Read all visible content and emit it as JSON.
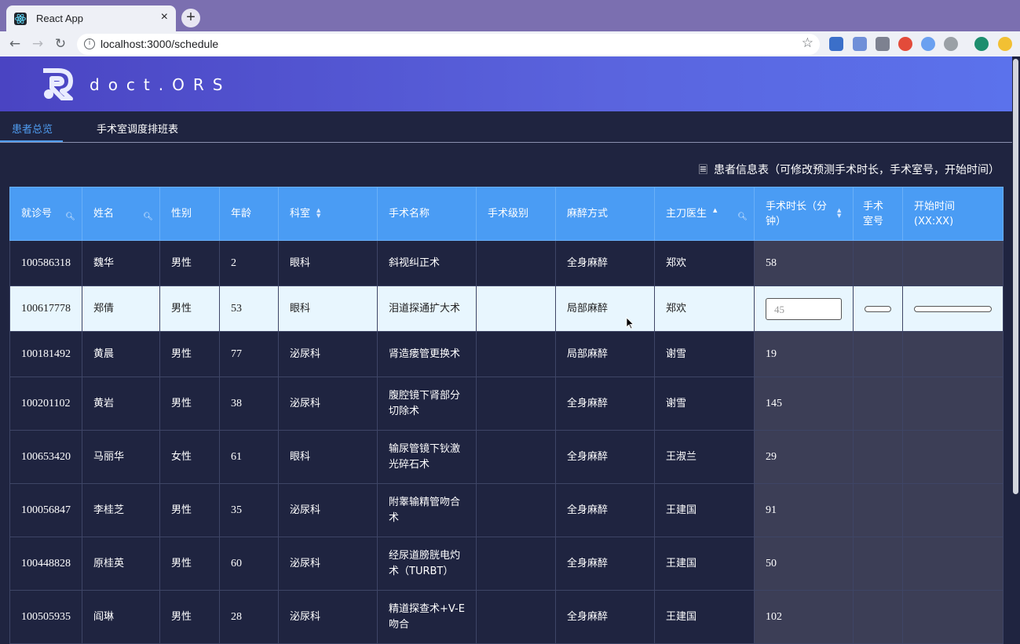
{
  "browser": {
    "tab_title": "React App",
    "tab_close": "×",
    "new_tab": "+",
    "url": "localhost:3000/schedule",
    "back": "←",
    "forward": "→",
    "reload": "↻",
    "star": "☆",
    "info": "i",
    "extensions": [
      "new-extension-icon",
      "translate-icon",
      "reader-icon",
      "chrome-icon",
      "send-icon",
      "vpn-icon",
      "profile-icon",
      "coin-icon"
    ]
  },
  "app": {
    "brand": "doct.ORS"
  },
  "tabs": [
    {
      "label": "患者总览",
      "active": true
    },
    {
      "label": "手术室调度排班表",
      "active": false
    }
  ],
  "table": {
    "title_icon": "🗏",
    "title": "患者信息表（可修改预测手术时长，手术室号，开始时间）",
    "columns": [
      {
        "label": "就诊号",
        "icon": "search-icon"
      },
      {
        "label": "姓名",
        "icon": "search-icon"
      },
      {
        "label": "性别"
      },
      {
        "label": "年龄"
      },
      {
        "label": "科室",
        "icon": "sort-icon"
      },
      {
        "label": "手术名称"
      },
      {
        "label": "手术级别"
      },
      {
        "label": "麻醉方式"
      },
      {
        "label": "主刀医生",
        "icon": "sort-asc-search-icon"
      },
      {
        "label": "手术时长（分钟）",
        "icon": "sort-icon"
      },
      {
        "label": "手术室号"
      },
      {
        "label": "开始时间(XX:XX)"
      }
    ],
    "rows": [
      {
        "id": "100586318",
        "name": "魏华",
        "gender": "男性",
        "age": "2",
        "dept": "眼科",
        "surgery": "斜视纠正术",
        "level": "",
        "anesthesia": "全身麻醉",
        "surgeon": "郑欢",
        "duration": "58",
        "room": "",
        "start": ""
      },
      {
        "id": "100617778",
        "name": "郑倩",
        "gender": "男性",
        "age": "53",
        "dept": "眼科",
        "surgery": "泪道探通扩大术",
        "level": "",
        "anesthesia": "局部麻醉",
        "surgeon": "郑欢",
        "duration": "45",
        "room": "",
        "start": "",
        "editing": true
      },
      {
        "id": "100181492",
        "name": "黄晨",
        "gender": "男性",
        "age": "77",
        "dept": "泌尿科",
        "surgery": "肾造瘘管更换术",
        "level": "",
        "anesthesia": "局部麻醉",
        "surgeon": "谢雪",
        "duration": "19",
        "room": "",
        "start": ""
      },
      {
        "id": "100201102",
        "name": "黄岩",
        "gender": "男性",
        "age": "38",
        "dept": "泌尿科",
        "surgery": "腹腔镜下肾部分切除术",
        "level": "",
        "anesthesia": "全身麻醉",
        "surgeon": "谢雪",
        "duration": "145",
        "room": "",
        "start": ""
      },
      {
        "id": "100653420",
        "name": "马丽华",
        "gender": "女性",
        "age": "61",
        "dept": "眼科",
        "surgery": "输尿管镜下钬激光碎石术",
        "level": "",
        "anesthesia": "全身麻醉",
        "surgeon": "王淑兰",
        "duration": "29",
        "room": "",
        "start": ""
      },
      {
        "id": "100056847",
        "name": "李桂芝",
        "gender": "男性",
        "age": "35",
        "dept": "泌尿科",
        "surgery": "附睾输精管吻合术",
        "level": "",
        "anesthesia": "全身麻醉",
        "surgeon": "王建国",
        "duration": "91",
        "room": "",
        "start": ""
      },
      {
        "id": "100448828",
        "name": "原桂英",
        "gender": "男性",
        "age": "60",
        "dept": "泌尿科",
        "surgery": "经尿道膀胱电灼术（TURBT）",
        "level": "",
        "anesthesia": "全身麻醉",
        "surgeon": "王建国",
        "duration": "50",
        "room": "",
        "start": ""
      },
      {
        "id": "100505935",
        "name": "阎琳",
        "gender": "男性",
        "age": "28",
        "dept": "泌尿科",
        "surgery": "精道探查术+V-E吻合",
        "level": "",
        "anesthesia": "全身麻醉",
        "surgeon": "王建国",
        "duration": "102",
        "room": "",
        "start": ""
      }
    ]
  },
  "colors": {
    "page_bg": "#1f2440",
    "header_start": "#4a44c2",
    "header_end": "#5b72ec",
    "table_header": "#4a9cf4",
    "active_tab": "#4f9cf0",
    "highlight_row": "#e8f6fe"
  }
}
